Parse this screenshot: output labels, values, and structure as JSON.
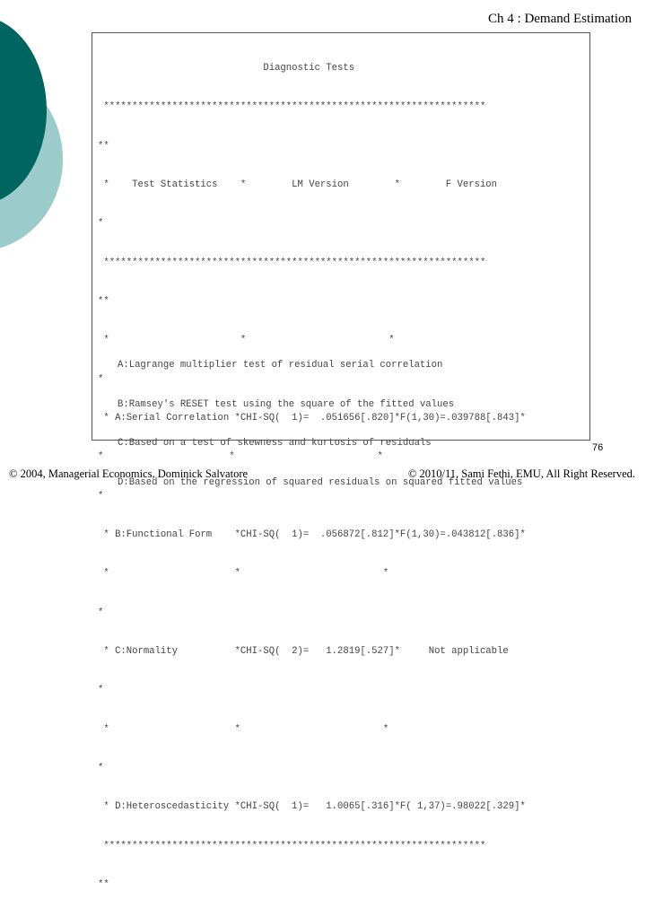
{
  "header": {
    "title": "Ch 4 : Demand Estimation"
  },
  "output": {
    "lines": [
      "                             Diagnostic Tests",
      " *******************************************************************",
      "**",
      " *    Test Statistics    *        LM Version        *        F Version",
      "*",
      " *******************************************************************",
      "**",
      " *                       *                         *",
      "*",
      " * A:Serial Correlation *CHI-SQ(  1)=  .051656[.820]*F(1,30)=.039788[.843]*",
      "*                      *                         *",
      "*",
      " * B:Functional Form    *CHI-SQ(  1)=  .056872[.812]*F(1,30)=.043812[.836]*",
      " *                      *                         *",
      "*",
      " * C:Normality          *CHI-SQ(  2)=   1.2819[.527]*     Not applicable",
      "*",
      " *                      *                         *",
      "*",
      " * D:Heteroscedasticity *CHI-SQ(  1)=   1.0065[.316]*F( 1,37)=.98022[.329]*",
      " *******************************************************************",
      "**"
    ],
    "notes": [
      "A:Lagrange multiplier test of residual serial correlation",
      "B:Ramsey's RESET test using the square of the fitted values",
      "C:Based on a test of skewness and kurtosis of residuals",
      "D:Based on the regression of squared residuals on squared fitted values"
    ]
  },
  "page_number": "76",
  "footer": {
    "left": "© 2004,  Managerial Economics, Dominick Salvatore",
    "right": "© 2010/11, Sami Fethi, EMU, All Right Reserved."
  },
  "colors": {
    "dark_teal": "#006561",
    "light_teal": "#9ccbcb",
    "text_gray": "#444444"
  }
}
